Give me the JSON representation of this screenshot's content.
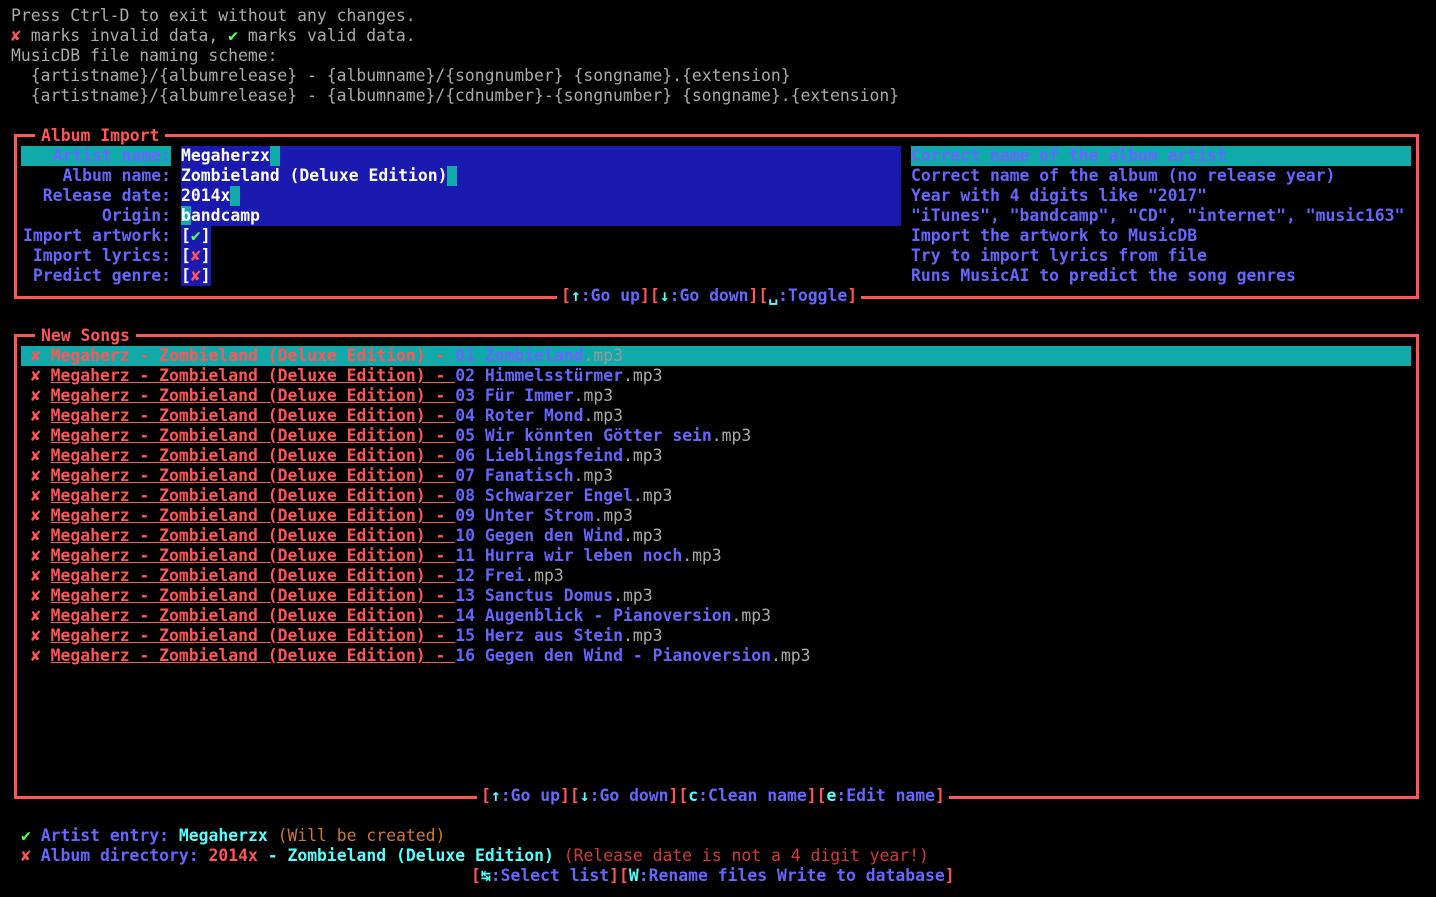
{
  "header": {
    "exit_hint": "Press Ctrl-D to exit without any changes.",
    "invalid_mark": "✘",
    "invalid_text": " marks invalid data, ",
    "valid_mark": "✔",
    "valid_text": " marks valid data.",
    "scheme_title": "MusicDB file naming scheme:",
    "scheme_1": "  {artistname}/{albumrelease} - {albumname}/{songnumber} {songname}.{extension}",
    "scheme_2": "  {artistname}/{albumrelease} - {albumname}/{cdnumber}-{songnumber} {songname}.{extension}"
  },
  "album_import": {
    "title": "Album Import",
    "fields": [
      {
        "label": "Artist name:",
        "value": "Megaherzx",
        "help": "Correct name of the album artist",
        "active": true
      },
      {
        "label": "Album name:",
        "value": "Zombieland (Deluxe Edition)",
        "help": "Correct name of the album (no release year)"
      },
      {
        "label": "Release date:",
        "value": "2014x",
        "help": "Year with 4 digits like \"2017\""
      },
      {
        "label": "Origin:",
        "value_first": "b",
        "value_rest": "andcamp",
        "help": "\"iTunes\", \"bandcamp\", \"CD\", \"internet\", \"music163\""
      }
    ],
    "checks": [
      {
        "label": "Import artwork:",
        "open": "[",
        "mark": "✔",
        "close": "]",
        "help": "Import the artwork to MusicDB"
      },
      {
        "label": "Import lyrics:",
        "open": "[",
        "mark": "✘",
        "close": "]",
        "help": "Try to import lyrics from file"
      },
      {
        "label": "Predict genre:",
        "open": "[",
        "mark": "✘",
        "close": "]",
        "help": "Runs MusicAI to predict the song genres"
      }
    ],
    "hints": {
      "k1": "↑",
      "t1": ":Go up",
      "k2": "↓",
      "t2": ":Go down",
      "k3": "␣",
      "t3": ":Toggle"
    }
  },
  "new_songs": {
    "title": "New Songs",
    "mark": "✘",
    "artist_prefix": "Megaherz - Zombieland (Deluxe Edition) - ",
    "songs": [
      {
        "num": "01 ",
        "name": "Zombieland",
        "ext": ".mp3"
      },
      {
        "num": "02 ",
        "name": "Himmelsstürmer",
        "ext": ".mp3"
      },
      {
        "num": "03 ",
        "name": "Für Immer",
        "ext": ".mp3"
      },
      {
        "num": "04 ",
        "name": "Roter Mond",
        "ext": ".mp3"
      },
      {
        "num": "05 ",
        "name": "Wir könnten Götter sein",
        "ext": ".mp3"
      },
      {
        "num": "06 ",
        "name": "Lieblingsfeind",
        "ext": ".mp3"
      },
      {
        "num": "07 ",
        "name": "Fanatisch",
        "ext": ".mp3"
      },
      {
        "num": "08 ",
        "name": "Schwarzer Engel",
        "ext": ".mp3"
      },
      {
        "num": "09 ",
        "name": "Unter Strom",
        "ext": ".mp3"
      },
      {
        "num": "10 ",
        "name": "Gegen den Wind",
        "ext": ".mp3"
      },
      {
        "num": "11 ",
        "name": "Hurra wir leben noch",
        "ext": ".mp3"
      },
      {
        "num": "12 ",
        "name": "Frei",
        "ext": ".mp3"
      },
      {
        "num": "13 ",
        "name": "Sanctus Domus",
        "ext": ".mp3"
      },
      {
        "num": "14 ",
        "name": "Augenblick - Pianoversion",
        "ext": ".mp3"
      },
      {
        "num": "15 ",
        "name": "Herz aus Stein",
        "ext": ".mp3"
      },
      {
        "num": "16 ",
        "name": "Gegen den Wind - Pianoversion",
        "ext": ".mp3"
      }
    ],
    "hints": {
      "k1": "↑",
      "t1": ":Go up",
      "k2": "↓",
      "t2": ":Go down",
      "k3": "c",
      "t3": ":Clean name",
      "k4": "e",
      "t4": ":Edit name"
    }
  },
  "footer": {
    "artist_mark": "✔",
    "artist_label": " Artist entry: ",
    "artist_value": "Megaherzx",
    "artist_note": " (Will be created)",
    "album_mark": "✘",
    "album_label": " Album directory: ",
    "album_date": "2014x",
    "album_sep": " - ",
    "album_name": "Zombieland (Deluxe Edition)",
    "album_note": " (Release date is not a 4 digit year!)",
    "hints": {
      "k1": "↹",
      "t1": ":Select list",
      "k2": "W",
      "t2": ":Rename files Write to database"
    }
  }
}
